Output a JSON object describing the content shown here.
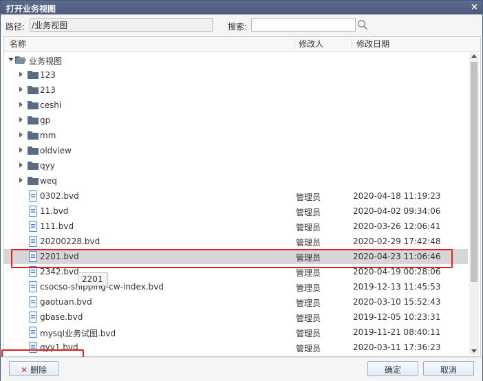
{
  "dialog": {
    "title": "打开业务视图",
    "close_glyph": "×"
  },
  "toolbar": {
    "path_label": "路径:",
    "path_value": "/业务视图",
    "search_label": "搜索:",
    "search_value": ""
  },
  "grid": {
    "columns": {
      "name": "名称",
      "modifier": "修改人",
      "modified_date": "修改日期"
    },
    "root": {
      "label": "业务视图"
    },
    "folders": [
      {
        "label": "123"
      },
      {
        "label": "213"
      },
      {
        "label": "ceshi"
      },
      {
        "label": "gp"
      },
      {
        "label": "mm"
      },
      {
        "label": "oldview"
      },
      {
        "label": "qyy"
      },
      {
        "label": "weq"
      }
    ],
    "files": [
      {
        "name": "0302.bvd",
        "modifier": "管理员",
        "date": "2020-04-18 11:19:23"
      },
      {
        "name": "11.bvd",
        "modifier": "管理员",
        "date": "2020-04-02 09:34:06"
      },
      {
        "name": "111.bvd",
        "modifier": "管理员",
        "date": "2020-03-26 12:06:41"
      },
      {
        "name": "20200228.bvd",
        "modifier": "管理员",
        "date": "2020-02-29 17:42:48"
      },
      {
        "name": "2201.bvd",
        "modifier": "管理员",
        "date": "2020-04-23 11:06:46"
      },
      {
        "name": "2342.bvd",
        "modifier": "管理员",
        "date": "2020-04-19 00:28:06"
      },
      {
        "name": "csocso-shipping-cw-index.bvd",
        "modifier": "管理员",
        "date": "2019-12-13 11:45:53"
      },
      {
        "name": "gaotuan.bvd",
        "modifier": "管理员",
        "date": "2020-03-10 15:52:43"
      },
      {
        "name": "gbase.bvd",
        "modifier": "管理员",
        "date": "2019-12-05 10:23:31"
      },
      {
        "name": "mysql业务试图.bvd",
        "modifier": "管理员",
        "date": "2019-11-21 08:40:11"
      },
      {
        "name": "qyy1.bvd",
        "modifier": "管理员",
        "date": "2020-03-11 17:36:23"
      }
    ],
    "selected_file": "2201.bvd",
    "tooltip": "2201"
  },
  "footer": {
    "delete_label": "删除",
    "ok_label": "确定",
    "cancel_label": "取消"
  },
  "colors": {
    "titlebar": "#4f5e80",
    "highlight_box": "#e02020",
    "selected_row": "#d6d6d6",
    "folder_icon": "#5a6b83",
    "file_icon": "#3f7fd0"
  },
  "icons": {
    "folder": "folder-icon",
    "file": "file-icon",
    "search": "search-icon",
    "delete": "delete-icon",
    "close": "close-icon"
  }
}
